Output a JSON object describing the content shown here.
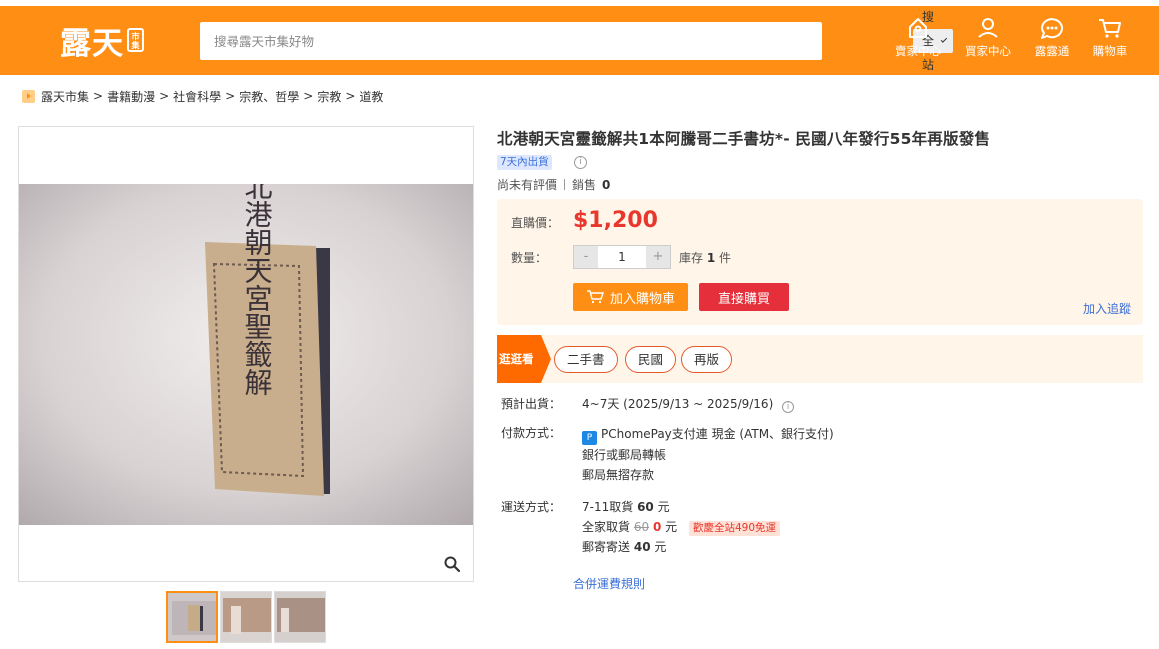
{
  "header": {
    "logo_text": "露天",
    "logo_badge": "市集",
    "search_placeholder": "搜尋露天市集好物",
    "search_scope": "搜全站",
    "nav": [
      {
        "label": "賣家中心",
        "icon": "store-icon"
      },
      {
        "label": "買家中心",
        "icon": "user-icon"
      },
      {
        "label": "露露通",
        "icon": "chat-icon"
      },
      {
        "label": "購物車",
        "icon": "cart-icon"
      }
    ]
  },
  "breadcrumb": [
    "露天市集",
    "書籍動漫",
    "社會科學",
    "宗教、哲學",
    "宗教",
    "道教"
  ],
  "book_cover_text": "北港朝天宮聖籤解",
  "product": {
    "title": "北港朝天宮靈籤解共1本阿騰哥二手書坊*- 民國八年發行55年再版發售",
    "ship_tag": "7天內出貨",
    "rating_text": "尚未有評價",
    "sales_label": "銷售",
    "sales_count": "0",
    "price_label": "直購價：",
    "price": "$1,200",
    "qty_label": "數量：",
    "qty_minus": "-",
    "qty_value": "1",
    "qty_plus": "+",
    "stock_prefix": "庫存",
    "stock_count": "1",
    "stock_unit": "件",
    "add_cart_label": "加入購物車",
    "buy_now_label": "直接購買",
    "track_label": "加入追蹤"
  },
  "tags": {
    "ribbon": "逛逛看",
    "items": [
      "二手書",
      "民國",
      "再版"
    ]
  },
  "shipping": {
    "eta_label": "預計出貨：",
    "eta_value": "4~7天 (2025/9/13 ~ 2025/9/16)",
    "pay_label": "付款方式：",
    "pay_lines": [
      "PChomePay支付連 現金 (ATM、銀行支付)",
      "銀行或郵局轉帳",
      "郵局無摺存款"
    ],
    "ship_label": "運送方式：",
    "ship_711": "7-11取貨",
    "ship_711_price": "60",
    "ship_family": "全家取貨",
    "ship_family_old": "60",
    "ship_family_price": "0",
    "ship_post": "郵寄寄送",
    "ship_post_price": "40",
    "unit": "元",
    "promo": "歡慶全站490免運",
    "merge_link": "合併運費規則"
  },
  "colors": {
    "brand": "#ff8f14",
    "price": "#e8382d",
    "buy": "#e52f3a",
    "link": "#3b6fd8"
  }
}
